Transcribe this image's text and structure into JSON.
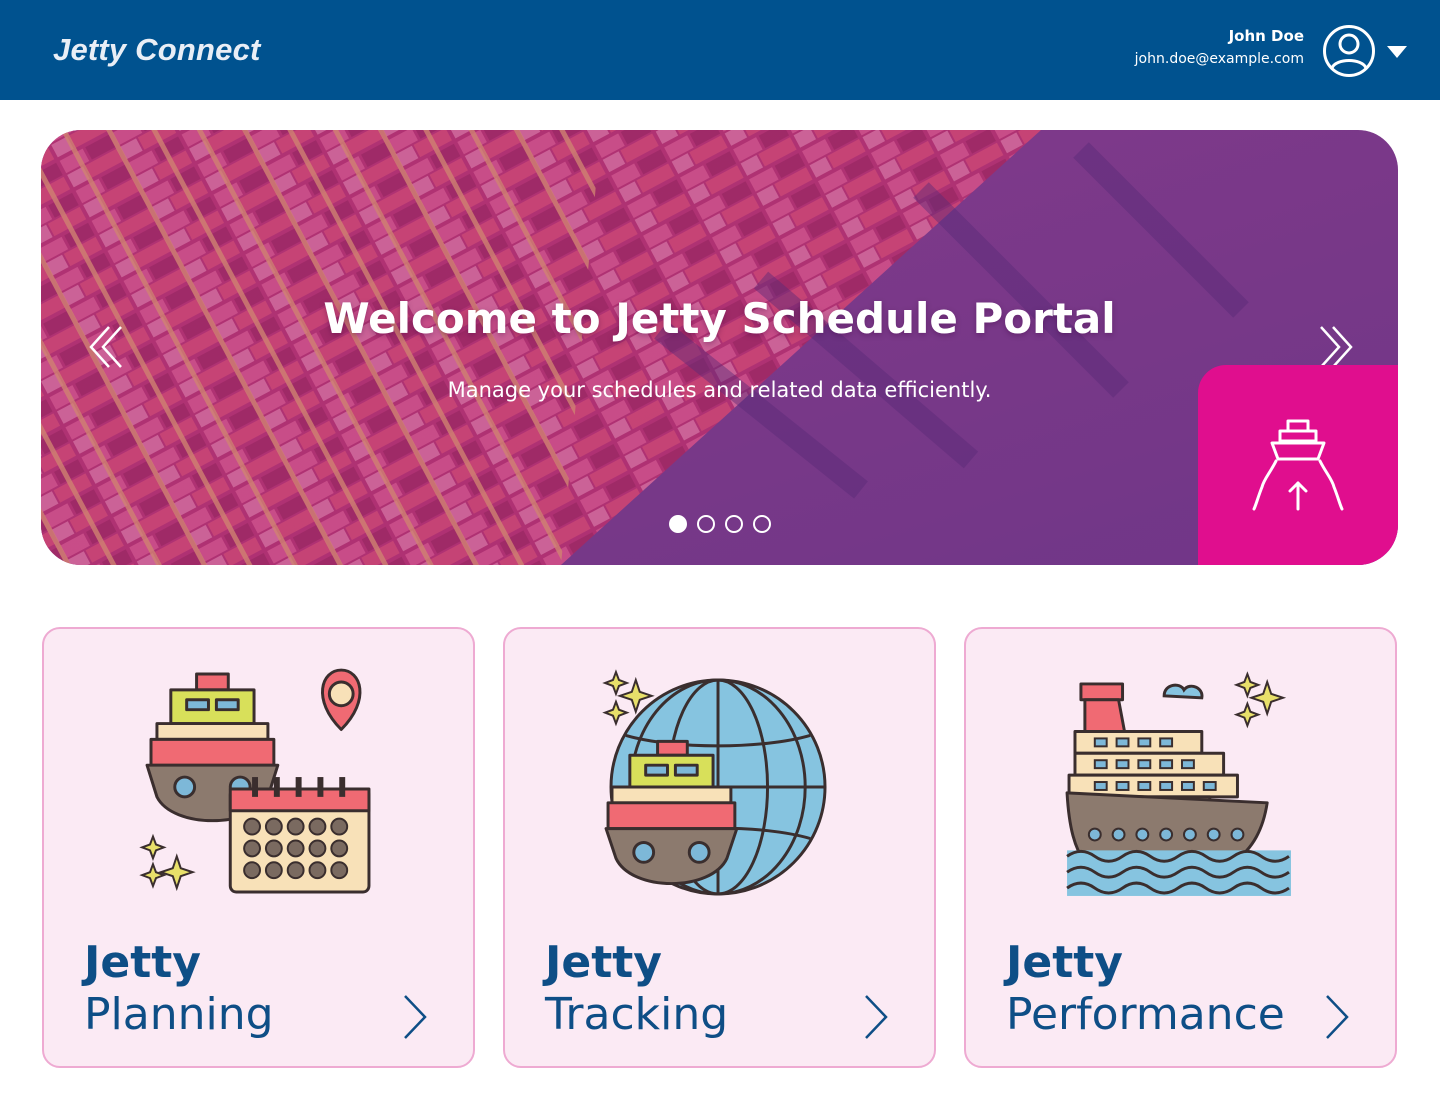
{
  "header": {
    "brand": "Jetty Connect",
    "user_name": "John Doe",
    "user_email": "john.doe@example.com"
  },
  "hero": {
    "title": "Welcome to Jetty Schedule Portal",
    "subtitle": "Manage your schedules and related data efficiently.",
    "slide_count": 4,
    "active_slide": 1
  },
  "cards": [
    {
      "title_bold": "Jetty",
      "title_light": "Planning"
    },
    {
      "title_bold": "Jetty",
      "title_light": "Tracking"
    },
    {
      "title_bold": "Jetty",
      "title_light": "Performance"
    }
  ],
  "colors": {
    "header_bg": "#00528f",
    "badge": "#e00e8e",
    "card_bg": "#fbeaf4",
    "card_border": "#eeaad2",
    "card_text": "#0e4e86"
  }
}
